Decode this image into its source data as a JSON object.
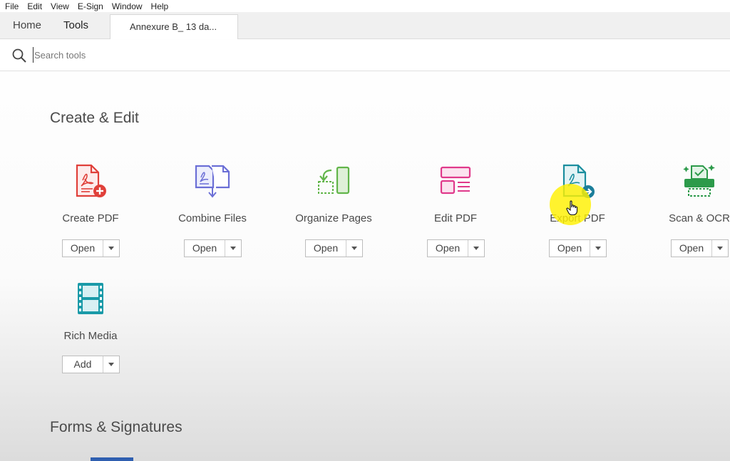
{
  "menu": [
    "File",
    "Edit",
    "View",
    "E-Sign",
    "Window",
    "Help"
  ],
  "tabs": {
    "home": "Home",
    "tools": "Tools",
    "document": "Annexure B_ 13 da..."
  },
  "search": {
    "placeholder": "Search tools"
  },
  "sections": {
    "create_edit": "Create & Edit",
    "forms_signatures": "Forms & Signatures"
  },
  "tools": [
    {
      "label": "Create PDF",
      "button": "Open",
      "icon": "create-pdf-icon"
    },
    {
      "label": "Combine Files",
      "button": "Open",
      "icon": "combine-files-icon"
    },
    {
      "label": "Organize Pages",
      "button": "Open",
      "icon": "organize-pages-icon"
    },
    {
      "label": "Edit PDF",
      "button": "Open",
      "icon": "edit-pdf-icon"
    },
    {
      "label": "Export PDF",
      "button": "Open",
      "icon": "export-pdf-icon"
    },
    {
      "label": "Scan & OCR",
      "button": "Open",
      "icon": "scan-ocr-icon"
    },
    {
      "label": "Rich Media",
      "button": "Add",
      "icon": "rich-media-icon"
    }
  ],
  "colors": {
    "create_pdf": "#e0403a",
    "combine_files": "#6b6fd6",
    "organize_pages": "#62b54a",
    "edit_pdf": "#e0398b",
    "export_pdf": "#1b8e9e",
    "scan_ocr": "#2c9a4a",
    "rich_media": "#1a9aa8",
    "highlight": "#fff000"
  }
}
